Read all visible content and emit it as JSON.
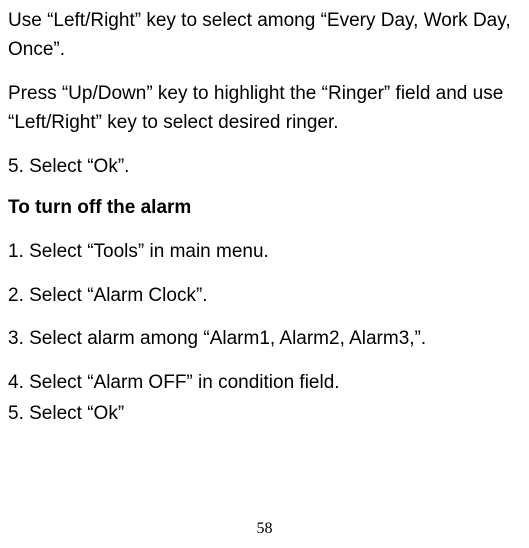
{
  "paragraphs": {
    "p1": "Use “Left/Right” key to select among “Every Day, Work Day, Once”.",
    "p2": "Press “Up/Down” key to highlight the “Ringer” field and use “Left/Right” key to select desired ringer.",
    "p3": "5. Select “Ok”."
  },
  "heading": "To turn off the alarm",
  "steps": {
    "s1": "1. Select “Tools” in main menu.",
    "s2": "2. Select “Alarm Clock”.",
    "s3": "3. Select alarm among “Alarm1, Alarm2, Alarm3,”.",
    "s4": "4. Select “Alarm OFF” in condition field.",
    "s5": "5. Select “Ok”"
  },
  "page_number": "58"
}
